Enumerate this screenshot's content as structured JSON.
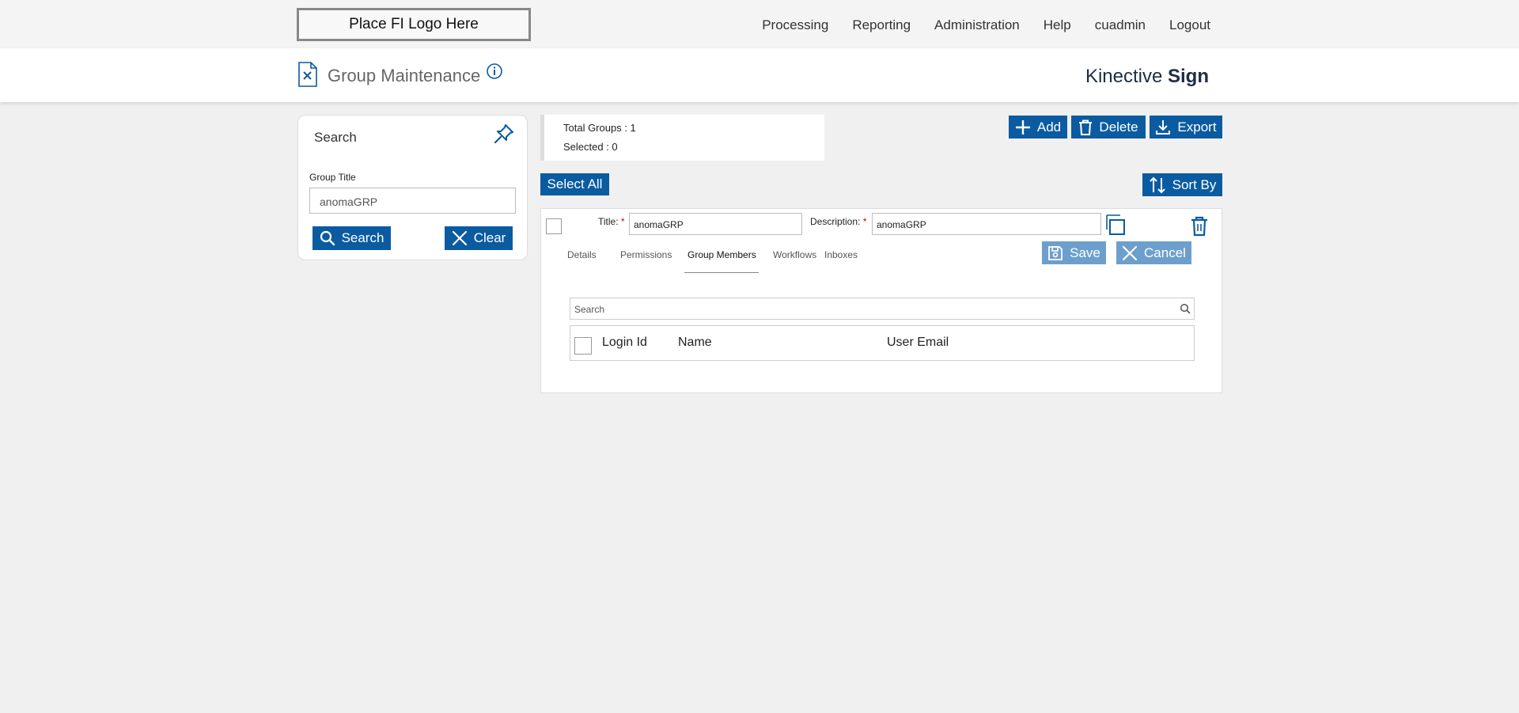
{
  "logo": {
    "text": "Place FI Logo Here"
  },
  "nav": {
    "items": [
      "Processing",
      "Reporting",
      "Administration",
      "Help",
      "cuadmin",
      "Logout"
    ]
  },
  "header": {
    "title": "Group Maintenance",
    "brand_light": "Kinective ",
    "brand_bold": "Sign"
  },
  "search_panel": {
    "title": "Search",
    "group_title_label": "Group Title",
    "group_title_value": "anomaGRP",
    "search_button": "Search",
    "clear_button": "Clear"
  },
  "stats": {
    "total_groups": "Total Groups : 1",
    "selected": "Selected : 0"
  },
  "toolbar": {
    "add": "Add",
    "delete": "Delete",
    "export": "Export",
    "select_all": "Select All",
    "sort_by": "Sort By"
  },
  "group_card": {
    "title_label": "Title:",
    "title_value": "anomaGRP",
    "description_label": "Description:",
    "description_value": "anomaGRP",
    "required_mark": "*",
    "save": "Save",
    "cancel": "Cancel",
    "tabs": [
      "Details",
      "Permissions",
      "Group Members",
      "Workflows",
      "Inboxes"
    ],
    "active_tab": "Group Members",
    "member_search_placeholder": "Search",
    "columns": [
      "Login Id",
      "Name",
      "User Email"
    ]
  },
  "colors": {
    "primary": "#0b5ba1",
    "disabled_button": "#6d9fcc",
    "required": "#cc0000"
  }
}
